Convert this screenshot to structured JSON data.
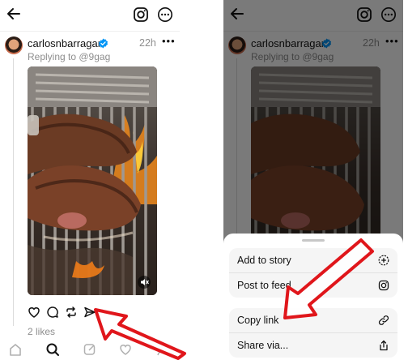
{
  "post": {
    "username": "carlosnbarragan",
    "time": "22h",
    "reply_to": "Replying to @9gag",
    "likes": "2 likes"
  },
  "share_sheet": {
    "items": [
      {
        "label": "Add to story",
        "icon": "add-story-icon"
      },
      {
        "label": "Post to feed",
        "icon": "instagram-icon"
      },
      {
        "label": "Copy link",
        "icon": "link-icon"
      },
      {
        "label": "Share via...",
        "icon": "share-icon"
      }
    ]
  },
  "icons": {
    "header": [
      "back-arrow-icon",
      "instagram-icon",
      "more-icon"
    ],
    "actions": [
      "heart-icon",
      "comment-icon",
      "repost-icon",
      "send-icon"
    ],
    "nav": [
      "home-icon",
      "search-icon",
      "compose-icon",
      "activity-icon",
      "profile-icon"
    ]
  },
  "colors": {
    "verified": "#0095f6",
    "annotation_arrow": "#e0161b",
    "secondary_text": "#8e8e8e"
  }
}
